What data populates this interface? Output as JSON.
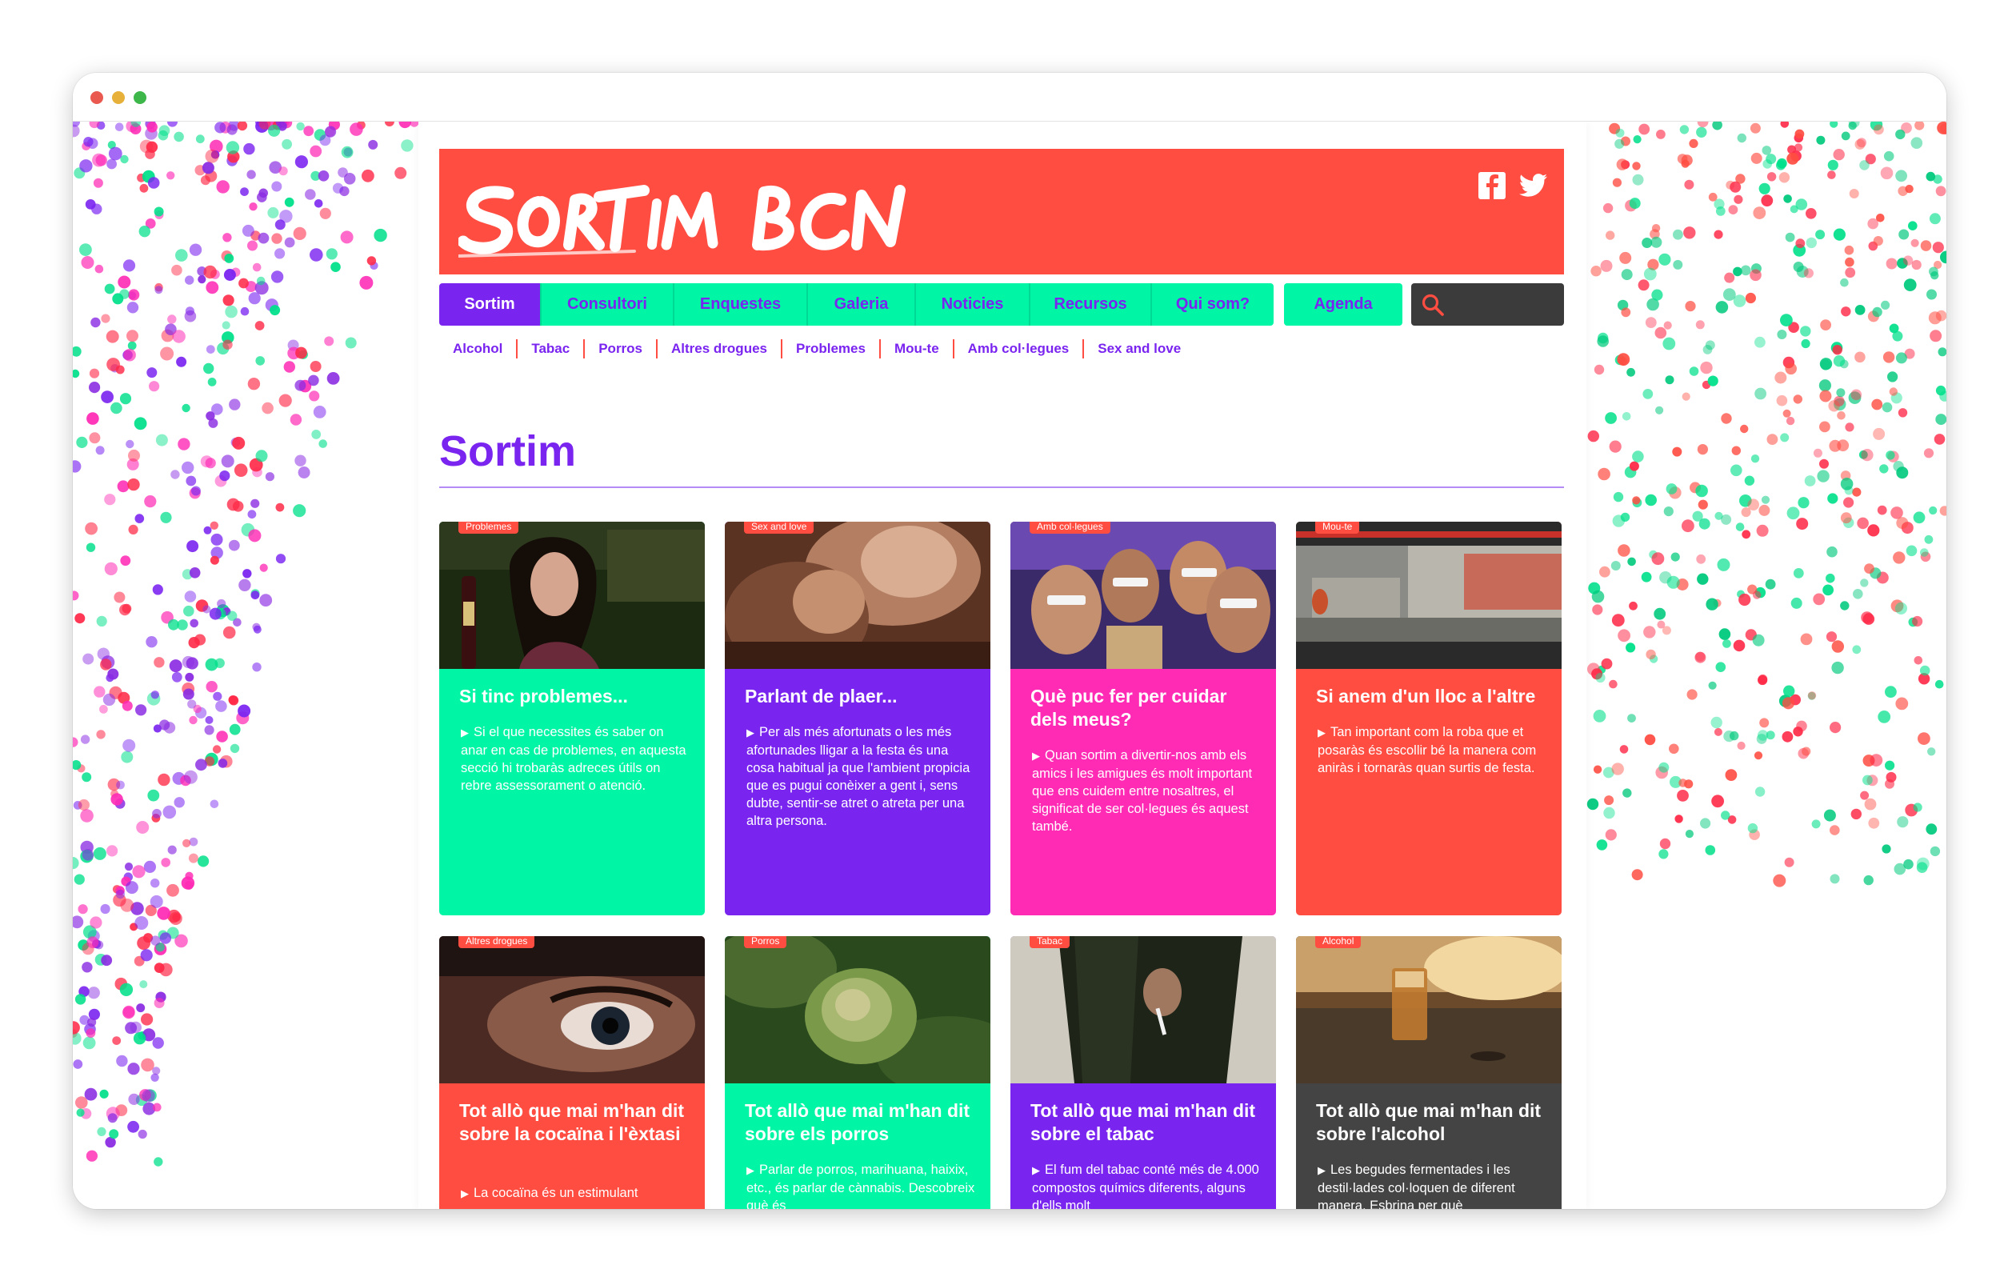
{
  "site": {
    "logo_text": "SORTIM BCN"
  },
  "social": [
    "facebook-icon",
    "twitter-icon"
  ],
  "nav": [
    {
      "label": "Sortim",
      "active": true
    },
    {
      "label": "Consultori"
    },
    {
      "label": "Enquestes"
    },
    {
      "label": "Galeria"
    },
    {
      "label": "Noticies"
    },
    {
      "label": "Recursos"
    },
    {
      "label": "Qui som?"
    },
    {
      "label": "Agenda"
    }
  ],
  "search": {
    "placeholder": "",
    "icon": "search-icon"
  },
  "subnav": [
    "Alcohol",
    "Tabac",
    "Porros",
    "Altres drogues",
    "Problemes",
    "Mou-te",
    "Amb col·legues",
    "Sex and love"
  ],
  "page_title": "Sortim",
  "cards": [
    {
      "tag": "Problemes",
      "title": "Si tinc problemes...",
      "text": "Si el que necessites és saber on anar en cas de problemes, en aquesta secció hi trobaràs adreces útils on rebre assessorament o atenció.",
      "color": "#00f5a5"
    },
    {
      "tag": "Sex and love",
      "title": "Parlant de plaer...",
      "text": "Per als més afortunats o les més afortunades lligar a la festa és una cosa habitual ja que l'ambient propicia que es pugui conèixer a gent i, sens dubte, sentir-se atret o atreta per una altra persona.",
      "color": "#7a24f0"
    },
    {
      "tag": "Amb col·legues",
      "title": "Què puc fer per cuidar dels meus?",
      "text": "Quan sortim a divertir-nos amb els amics i les amigues és molt important que ens cuidem entre nosaltres, el significat de ser col·legues és aquest també.",
      "color": "#ff2bb5"
    },
    {
      "tag": "Mou-te",
      "title": "Si anem d'un lloc a l'altre",
      "text": "Tan important com la roba que et posaràs és escollir bé la manera com aniràs i tornaràs quan surtis de festa.",
      "color": "#ff4d42"
    },
    {
      "tag": "Altres drogues",
      "title": "Tot allò que mai m'han dit sobre la cocaïna i l'èxtasi",
      "text": "La cocaïna és un estimulant",
      "color": "#ff4d42"
    },
    {
      "tag": "Porros",
      "title": "Tot allò que mai m'han dit sobre els porros",
      "text": "Parlar de porros, marihuana, haixix, etc., és parlar de cànnabis. Descobreix què és",
      "color": "#00f5a5"
    },
    {
      "tag": "Tabac",
      "title": "Tot allò que mai m'han dit sobre el tabac",
      "text": "El fum del tabac conté més de 4.000 compostos químics diferents, alguns d'ells molt",
      "color": "#7a24f0"
    },
    {
      "tag": "Alcohol",
      "title": "Tot allò que mai m'han dit sobre l'alcohol",
      "text": "Les begudes fermentades i les destil·lades col·loquen de diferent manera. Esbrina per què",
      "color": "#444444"
    }
  ]
}
